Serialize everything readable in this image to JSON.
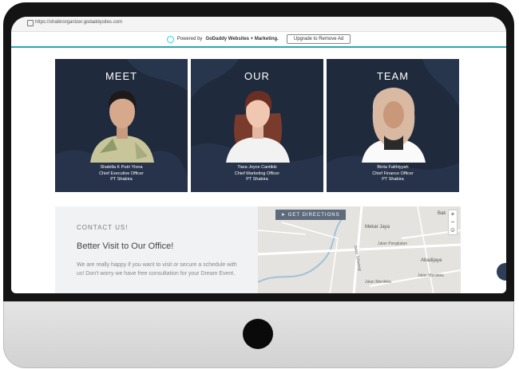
{
  "browser": {
    "url": "https://shabirorganizer.godaddysites.com"
  },
  "banner": {
    "text_prefix": "Powered by",
    "brand": "GoDaddy Websites + Marketing.",
    "upgrade_label": "Upgrade to Remove Ad"
  },
  "cards": [
    {
      "heading": "MEET",
      "name": "Shabilla K Putri Ylona",
      "role": "Chief Executive Officer",
      "company": "PT Shabira"
    },
    {
      "heading": "OUR",
      "name": "Tiara Joyce Cantikki",
      "role": "Chief Marketing Officer",
      "company": "PT Shabira"
    },
    {
      "heading": "TEAM",
      "name": "Binta Fatihiyyah",
      "role": "Chief Finance Officer",
      "company": "PT Shabira"
    }
  ],
  "contact": {
    "eyebrow": "CONTACT US!",
    "title": "Better Visit to Our Office!",
    "body": "We are really happy if you want to visit or secure a schedule with us! Don't worry we have free consultation for your Dream Event."
  },
  "map": {
    "directions_label": "GET DIRECTIONS",
    "zoom_in": "+",
    "zoom_out": "−",
    "labels": [
      "Bak",
      "Mekar Jaya",
      "Jalan Pangkalan",
      "Abadijaya",
      "Jalan Merdeka",
      "Jalan Merdeka",
      "Jalan Siliwangi"
    ]
  },
  "colors": {
    "card_bg": "#1f2a3d",
    "accent_teal": "#2aa6b0",
    "map_button": "#5d6b7d"
  }
}
